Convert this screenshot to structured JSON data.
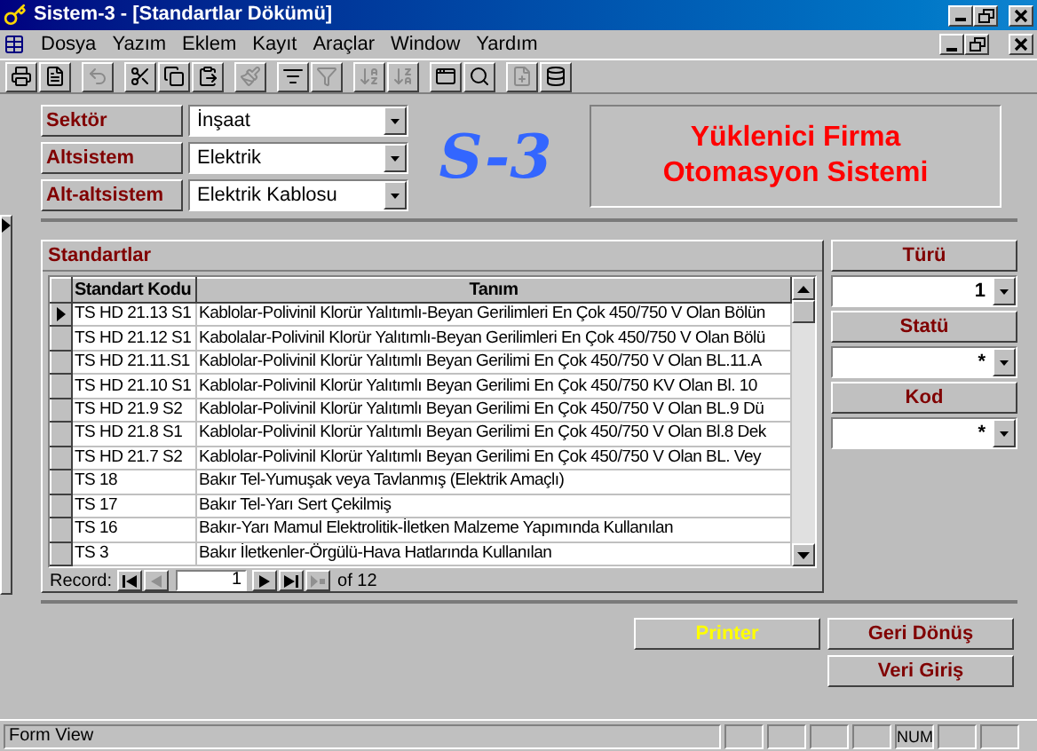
{
  "window": {
    "title": "Sistem-3 - [Standartlar Dökümü]"
  },
  "menu": [
    "Dosya",
    "Yazım",
    "Eklem",
    "Kayıt",
    "Araçlar",
    "Window",
    "Yardım"
  ],
  "toolbar": [
    {
      "kind": "print",
      "disabled": false
    },
    {
      "kind": "preview",
      "disabled": false
    },
    {
      "kind": "undo",
      "disabled": true
    },
    {
      "kind": "cut",
      "disabled": false
    },
    {
      "kind": "copy",
      "disabled": false
    },
    {
      "kind": "paste",
      "disabled": false
    },
    {
      "kind": "brush",
      "disabled": true
    },
    {
      "kind": "filter-form",
      "disabled": false
    },
    {
      "kind": "filter",
      "disabled": true
    },
    {
      "kind": "sort-asc",
      "disabled": true
    },
    {
      "kind": "sort-desc",
      "disabled": true
    },
    {
      "kind": "window",
      "disabled": false
    },
    {
      "kind": "find",
      "disabled": false
    },
    {
      "kind": "new",
      "disabled": true
    },
    {
      "kind": "database",
      "disabled": false
    }
  ],
  "filters": [
    {
      "label": "Sektör",
      "value": "İnşaat"
    },
    {
      "label": "Altsistem",
      "value": "Elektrik"
    },
    {
      "label": "Alt-altsistem",
      "value": "Elektrik Kablosu"
    }
  ],
  "logo": "S-3",
  "banner": [
    "Yüklenici Firma",
    "Otomasyon Sistemi"
  ],
  "table": {
    "title": "Standartlar",
    "columns": [
      "Standart Kodu",
      "Tanım"
    ],
    "rows": [
      {
        "code": "TS HD 21.13 S1",
        "desc": "Kablolar-Polivinil Klorür Yalıtımlı-Beyan Gerilimleri En Çok 450/750 V Olan Bölün",
        "selected": true
      },
      {
        "code": "TS HD 21.12 S1",
        "desc": "Kabolalar-Polivinil Klorür Yalıtımlı-Beyan Gerilimleri En Çok 450/750 V Olan Bölü",
        "selected": false
      },
      {
        "code": "TS HD 21.11.S1",
        "desc": "Kablolar-Polivinil Klorür Yalıtımlı Beyan Gerilimi En Çok 450/750 V Olan BL.11.A",
        "selected": false
      },
      {
        "code": "TS HD 21.10 S1",
        "desc": "Kablolar-Polivinil Klorür Yalıtımlı Beyan Gerilimi En Çok 450/750 KV Olan Bl. 10",
        "selected": false
      },
      {
        "code": "TS HD 21.9 S2",
        "desc": "Kablolar-Polivinil Klorür Yalıtımlı Beyan Gerilimi En Çok 450/750 V Olan BL.9 Dü",
        "selected": false
      },
      {
        "code": "TS HD 21.8 S1",
        "desc": "Kablolar-Polivinil Klorür Yalıtımlı Beyan Gerilimi En Çok 450/750 V Olan Bl.8 Dek",
        "selected": false
      },
      {
        "code": "TS HD 21.7 S2",
        "desc": "Kablolar-Polivinil Klorür Yalıtımlı Beyan Gerilimi En Çok 450/750 V Olan BL. Vey",
        "selected": false
      },
      {
        "code": "TS 18",
        "desc": "Bakır Tel-Yumuşak veya Tavlanmış (Elektrik Amaçlı)",
        "selected": false
      },
      {
        "code": "TS 17",
        "desc": "Bakır Tel-Yarı Sert Çekilmiş",
        "selected": false
      },
      {
        "code": "TS 16",
        "desc": "Bakır-Yarı Mamul Elektrolitik-İletken Malzeme Yapımında Kullanılan",
        "selected": false
      },
      {
        "code": "TS 3",
        "desc": "Bakır İletkenler-Örgülü-Hava Hatlarında Kullanılan",
        "selected": false
      }
    ],
    "nav": {
      "label": "Record:",
      "current": "1",
      "total": "of 12"
    }
  },
  "side_filters": [
    {
      "label": "Türü",
      "value": "1"
    },
    {
      "label": "Statü",
      "value": "*"
    },
    {
      "label": "Kod",
      "value": "*"
    }
  ],
  "buttons": [
    {
      "label": "Printer",
      "kind": "highlight"
    },
    {
      "label": "Geri Dönüş",
      "kind": "normal"
    },
    {
      "label": "Veri Giriş",
      "kind": "normal"
    }
  ],
  "status_bar": {
    "text": "Form View",
    "num_lock": "NUM"
  }
}
